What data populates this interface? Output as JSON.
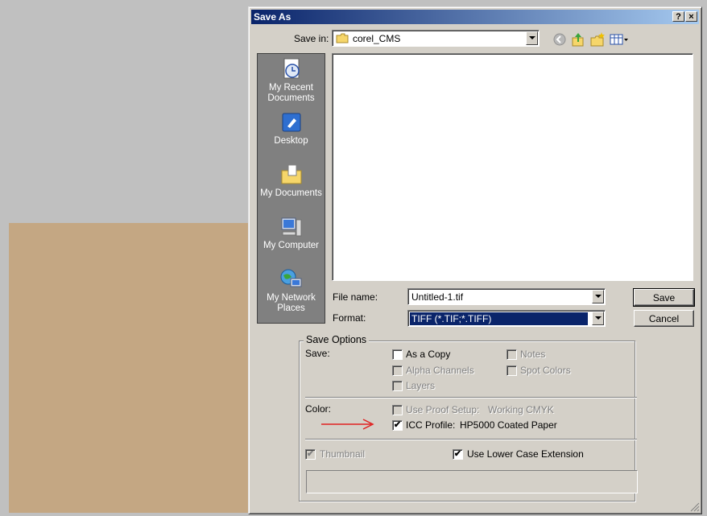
{
  "dialog": {
    "title": "Save As",
    "help_button": "?",
    "close_button": "×"
  },
  "save_in": {
    "label": "Save in:",
    "value": "corel_CMS"
  },
  "places": [
    {
      "label": "My Recent Documents",
      "icon": "recent-documents-icon"
    },
    {
      "label": "Desktop",
      "icon": "desktop-icon"
    },
    {
      "label": "My Documents",
      "icon": "my-documents-icon"
    },
    {
      "label": "My Computer",
      "icon": "my-computer-icon"
    },
    {
      "label": "My Network Places",
      "icon": "network-places-icon"
    }
  ],
  "file_name": {
    "label": "File name:",
    "value": "Untitled-1.tif"
  },
  "format": {
    "label": "Format:",
    "value": "TIFF (*.TIF;*.TIFF)"
  },
  "buttons": {
    "save": "Save",
    "cancel": "Cancel"
  },
  "save_options": {
    "title": "Save Options",
    "save_label": "Save:",
    "as_a_copy": {
      "label": "As a Copy",
      "checked": false,
      "enabled": true
    },
    "notes": {
      "label": "Notes",
      "checked": false,
      "enabled": false
    },
    "alpha_channels": {
      "label": "Alpha Channels",
      "checked": false,
      "enabled": false
    },
    "spot_colors": {
      "label": "Spot Colors",
      "checked": false,
      "enabled": false
    },
    "layers": {
      "label": "Layers",
      "checked": false,
      "enabled": false
    },
    "color_label": "Color:",
    "use_proof_setup": {
      "label": "Use Proof Setup:",
      "value": "Working CMYK",
      "checked": false,
      "enabled": false
    },
    "icc_profile": {
      "label": "ICC Profile:",
      "value": "HP5000 Coated Paper",
      "checked": true,
      "enabled": true
    },
    "thumbnail": {
      "label": "Thumbnail",
      "checked": true,
      "enabled": false
    },
    "lower_case_ext": {
      "label": "Use Lower Case Extension",
      "checked": true,
      "enabled": true
    }
  },
  "colors": {
    "swatch": "#c4a783",
    "annotation_arrow": "#e02020",
    "title_bar": "#0a246a",
    "selection": "#0a246a"
  }
}
